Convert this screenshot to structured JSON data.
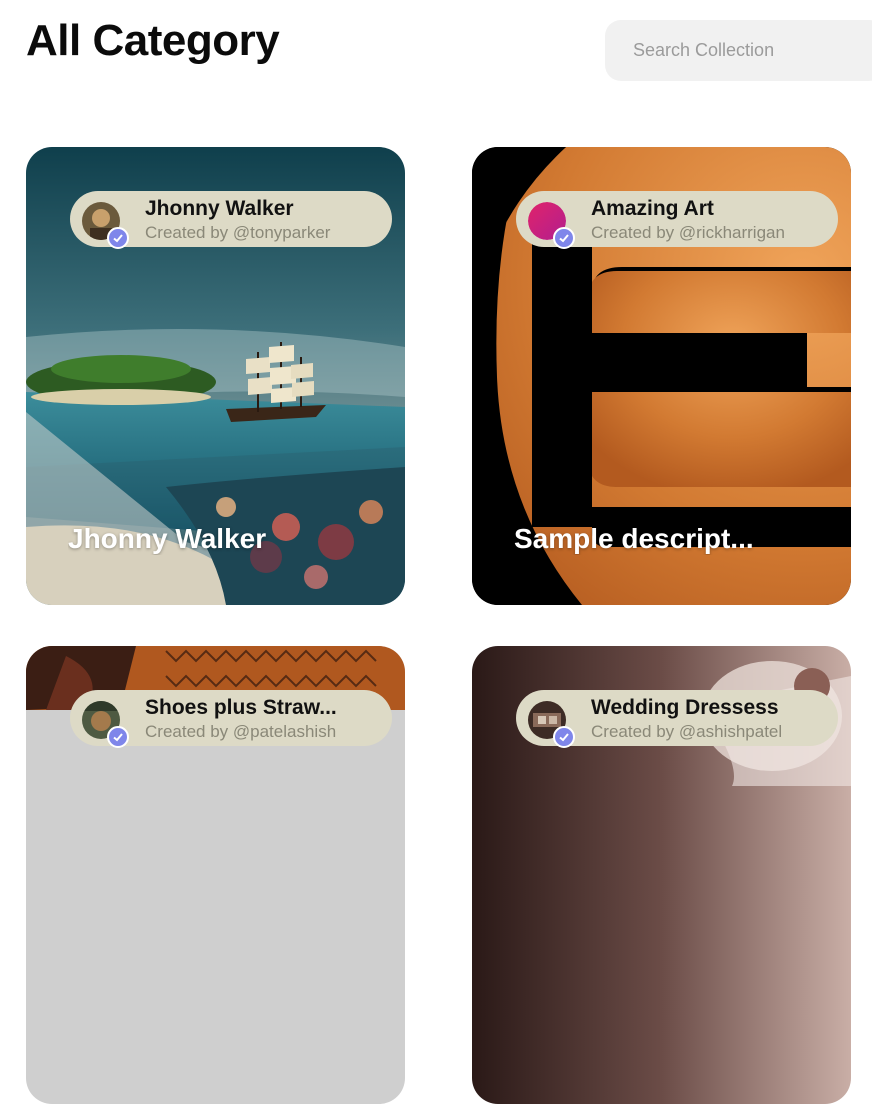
{
  "header": {
    "title": "All Category",
    "search_placeholder": "Search Collection"
  },
  "cards": [
    {
      "title": "Jhonny Walker",
      "creator": "Created by @tonyparker",
      "caption": "Jhonny Walker",
      "avatar_icon": "avatar-photo-icon",
      "verified_icon": "checkmark-icon"
    },
    {
      "title": "Amazing Art",
      "creator": "Created by @rickharrigan",
      "caption": "Sample descript...",
      "avatar_icon": "avatar-pink-icon",
      "verified_icon": "checkmark-icon"
    },
    {
      "title": "Shoes plus Straw...",
      "creator": "Created by @patelashish",
      "caption": "",
      "avatar_icon": "avatar-photo-icon",
      "verified_icon": "checkmark-icon"
    },
    {
      "title": "Wedding Dressess",
      "creator": "Created by @ashishpatel",
      "caption": "",
      "avatar_icon": "avatar-photo-icon",
      "verified_icon": "checkmark-icon"
    }
  ],
  "colors": {
    "pill_bg": "#dddac6",
    "verified_badge": "#7f86ea",
    "search_bg": "#f1f1f1"
  }
}
